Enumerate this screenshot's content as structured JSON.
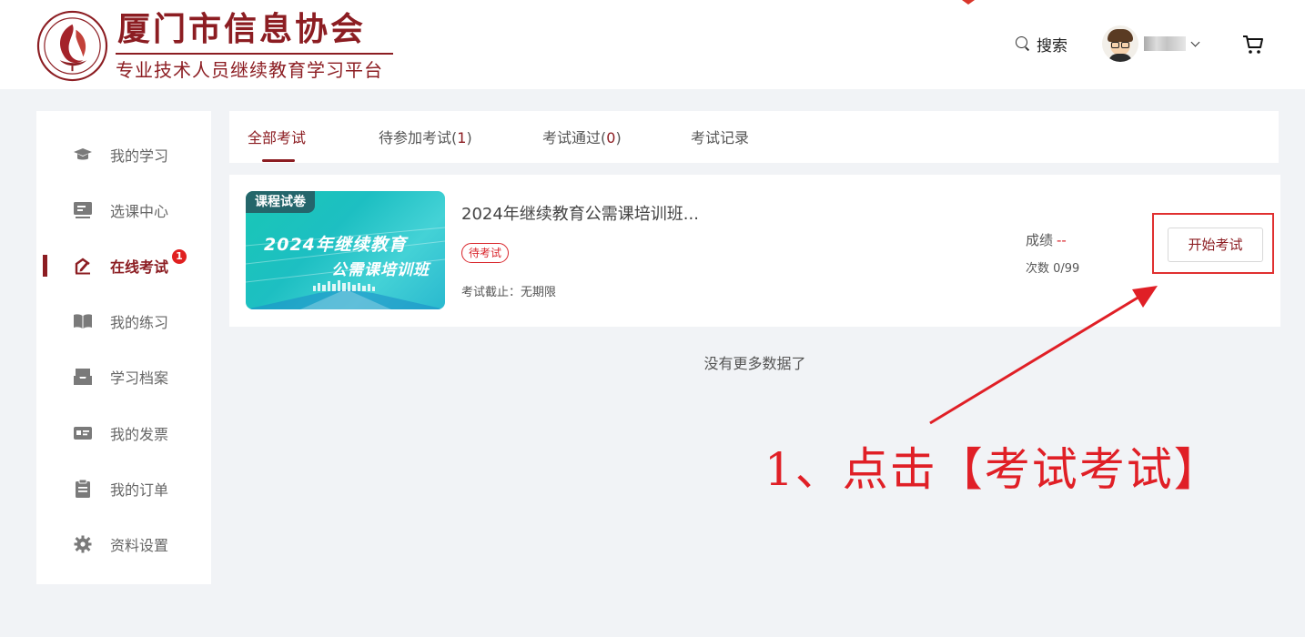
{
  "header": {
    "logo_title": "厦门市信息协会",
    "logo_subtitle": "专业技术人员继续教育学习平台",
    "search_label": "搜索",
    "user_name_masked": "",
    "icons": {
      "search": "search-icon",
      "cart": "cart-icon",
      "dropdown": "chevron-down-icon"
    }
  },
  "sidebar": {
    "items": [
      {
        "label": "我的学习",
        "icon": "graduation-cap-icon",
        "active": false
      },
      {
        "label": "选课中心",
        "icon": "monitor-icon",
        "active": false
      },
      {
        "label": "在线考试",
        "icon": "exam-pen-icon",
        "active": true,
        "badge": "1"
      },
      {
        "label": "我的练习",
        "icon": "book-icon",
        "active": false
      },
      {
        "label": "学习档案",
        "icon": "archive-icon",
        "active": false
      },
      {
        "label": "我的发票",
        "icon": "invoice-icon",
        "active": false
      },
      {
        "label": "我的订单",
        "icon": "clipboard-icon",
        "active": false
      },
      {
        "label": "资料设置",
        "icon": "gear-icon",
        "active": false
      }
    ]
  },
  "tabs": [
    {
      "label": "全部考试",
      "count": null,
      "active": true
    },
    {
      "label": "待参加考试",
      "count": "1",
      "active": false
    },
    {
      "label": "考试通过",
      "count": "0",
      "active": false
    },
    {
      "label": "考试记录",
      "count": null,
      "active": false
    }
  ],
  "exam": {
    "thumb_tag": "课程试卷",
    "thumb_line1": "2024年继续教育",
    "thumb_line2": "公需课培训班",
    "title": "2024年继续教育公需课培训班...",
    "status": "待考试",
    "deadline": "考试截止：无期限",
    "score_label": "成绩",
    "score_value": "--",
    "attempts": "次数 0/99",
    "start_button": "开始考试"
  },
  "list_footer": "没有更多数据了",
  "annotation": "1、点击【考试考试】",
  "colors": {
    "brand": "#8c1d22",
    "accent_red": "#e01f26",
    "background": "#f1f3f6"
  }
}
